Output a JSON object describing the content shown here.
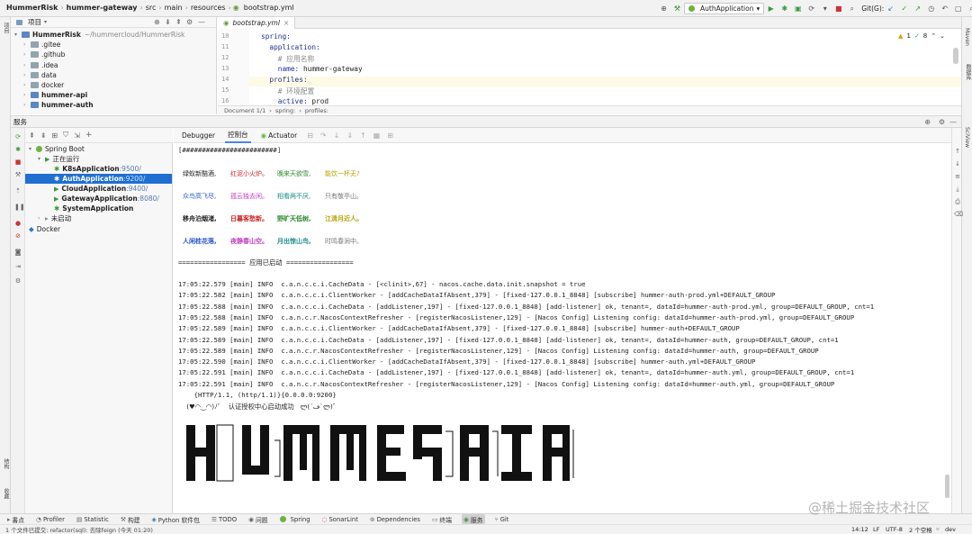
{
  "breadcrumb": [
    "HummerRisk",
    "hummer-gateway",
    "src",
    "main",
    "resources",
    "bootstrap.yml"
  ],
  "run_config": "AuthApplication",
  "git_label": "Git(G):",
  "left_strip_labels": [
    "项目",
    "结构",
    "收藏"
  ],
  "right_strip_labels": [
    "Maven",
    "数据库",
    "SciView"
  ],
  "project": {
    "header": "项目",
    "root_name": "HummerRisk",
    "root_path": "~/hummercloud/HummerRisk",
    "items": [
      ".gitee",
      ".github",
      ".idea",
      "data",
      "docker",
      "hummer-api",
      "hummer-auth"
    ]
  },
  "editor": {
    "tab": "bootstrap.yml",
    "warnings": "1",
    "checks": "8",
    "line_numbers": [
      "10",
      "11",
      "12",
      "13",
      "14",
      "15",
      "16"
    ],
    "lines": [
      {
        "k": "spring:",
        "v": ""
      },
      {
        "k": "  application:",
        "v": ""
      },
      {
        "k": "",
        "c": "    # 应用名称"
      },
      {
        "k": "    name:",
        "v": " hummer-gateway"
      },
      {
        "k": "  profiles:",
        "v": ""
      },
      {
        "k": "",
        "c": "    # 环境配置"
      },
      {
        "k": "    active:",
        "v": " prod"
      }
    ],
    "footer": [
      "Document 1/1",
      "spring:",
      "profiles:"
    ]
  },
  "services": {
    "title": "服务",
    "tree": {
      "spring_boot": "Spring Boot",
      "running": "正在运行",
      "apps": [
        {
          "name": "K8sApplication",
          "port": ":9500/"
        },
        {
          "name": "AuthApplication",
          "port": ":9200/"
        },
        {
          "name": "CloudApplication",
          "port": ":9400/"
        },
        {
          "name": "GatewayApplication",
          "port": ":8080/"
        },
        {
          "name": "SystemApplication",
          "port": ""
        }
      ],
      "not_started": "未启动",
      "docker": "Docker"
    }
  },
  "console": {
    "tabs": [
      "Debugger",
      "控制台",
      "Actuator"
    ],
    "hash_line": "[########################]",
    "poem_rows": [
      [
        "绿蚁新醅酒,",
        "红泥小火炉。",
        "晚来天欲雪,",
        "能饮一杯无?"
      ],
      [
        "众鸟高飞尽,",
        "孤云独去闲。",
        "相看两不厌,",
        "只有敬亭山。"
      ],
      [
        "移舟泊烟渚,",
        "日暮客愁新。",
        "野旷天低树,",
        "江清月近人。"
      ],
      [
        "人闲桂花落,",
        "夜静春山空。",
        "月出惊山鸟,",
        "时鸣春涧中。"
      ]
    ],
    "started": "================= 应用已启动 =================",
    "logs": [
      "17:05:22.579 [main] INFO  c.a.n.c.c.i.CacheData - [<clinit>,67] - nacos.cache.data.init.snapshot = true",
      "17:05:22.582 [main] INFO  c.a.n.c.c.i.ClientWorker - [addCacheDataIfAbsent,379] - [fixed-127.0.0.1_8848] [subscribe] hummer-auth-prod.yml+DEFAULT_GROUP",
      "17:05:22.588 [main] INFO  c.a.n.c.c.i.CacheData - [addListener,197] - [fixed-127.0.0.1_8848] [add-listener] ok, tenant=, dataId=hummer-auth-prod.yml, group=DEFAULT_GROUP, cnt=1",
      "17:05:22.588 [main] INFO  c.a.n.c.r.NacosContextRefresher - [registerNacosListener,129] - [Nacos Config] Listening config: dataId=hummer-auth-prod.yml, group=DEFAULT_GROUP",
      "17:05:22.589 [main] INFO  c.a.n.c.c.i.ClientWorker - [addCacheDataIfAbsent,379] - [fixed-127.0.0.1_8848] [subscribe] hummer-auth+DEFAULT_GROUP",
      "17:05:22.589 [main] INFO  c.a.n.c.c.i.CacheData - [addListener,197] - [fixed-127.0.0.1_8848] [add-listener] ok, tenant=, dataId=hummer-auth, group=DEFAULT_GROUP, cnt=1",
      "17:05:22.589 [main] INFO  c.a.n.c.r.NacosContextRefresher - [registerNacosListener,129] - [Nacos Config] Listening config: dataId=hummer-auth, group=DEFAULT_GROUP",
      "17:05:22.590 [main] INFO  c.a.n.c.c.i.ClientWorker - [addCacheDataIfAbsent,379] - [fixed-127.0.0.1_8848] [subscribe] hummer-auth.yml+DEFAULT_GROUP",
      "17:05:22.591 [main] INFO  c.a.n.c.c.i.CacheData - [addListener,197] - [fixed-127.0.0.1_8848] [add-listener] ok, tenant=, dataId=hummer-auth.yml, group=DEFAULT_GROUP, cnt=1",
      "17:05:22.591 [main] INFO  c.a.n.c.r.NacosContextRefresher - [registerNacosListener,129] - [Nacos Config] Listening config: dataId=hummer-auth.yml, group=DEFAULT_GROUP"
    ],
    "http_line": "    {HTTP/1.1, (http/1.1)}{0.0.0.0:9200}",
    "success_line": "    (♥◠‿◠)ﾉ゛  认证授权中心启动成功   ლ(´ڡ`ლ)゛"
  },
  "bottom_tools": [
    "書点",
    "Profiler",
    "Statistic",
    "构建",
    "Python 软件包",
    "TODO",
    "问题",
    "Spring",
    "SonarLint",
    "Dependencies",
    "终端",
    "服务",
    "Git"
  ],
  "status": {
    "message": "1 个文件已提交: refactor(sql): 去除feign (今天 01:20)",
    "time": "14:12",
    "lf": "LF",
    "encoding": "UTF-8",
    "indent": "2 个空格",
    "branch": "dev"
  },
  "watermark": "@稀土掘金技术社区",
  "colors": {
    "selection": "#1f6fd1",
    "poem_colors": [
      "#222222",
      "#cc2222",
      "#2a8a2a",
      "#b8a000"
    ]
  }
}
